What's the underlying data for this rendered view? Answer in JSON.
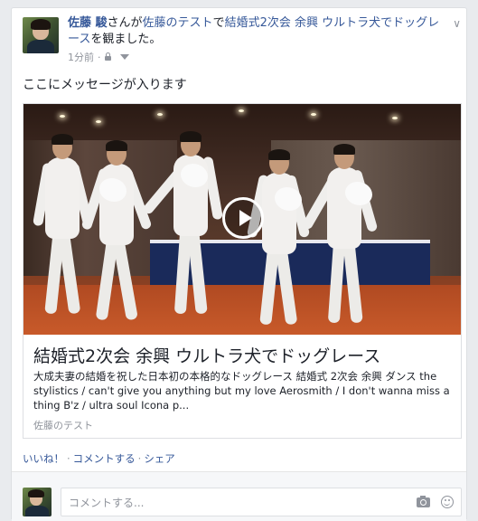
{
  "post": {
    "author": "佐藤 駿",
    "verb_pre": "さんが",
    "page_name": "佐藤のテスト",
    "verb_mid": "で",
    "video_title_link": "結婚式2次会 余興 ウルトラ犬でドッグレース",
    "verb_post": "を観ました。",
    "timestamp": "1分前",
    "timestamp_sep": "·",
    "message": "ここにメッセージが入ります"
  },
  "attachment": {
    "title": "結婚式2次会 余興 ウルトラ犬でドッグレース",
    "description": "大成夫妻の結婚を祝した日本初の本格的なドッグレース 結婚式 2次会 余興 ダンス the stylistics / can't give you anything but my love Aerosmith / I don't wanna miss a thing B'z / ultra soul Icona p...",
    "source": "佐藤のテスト"
  },
  "actions": {
    "like": "いいね！",
    "comment": "コメントする",
    "share": "シェア",
    "sep": "·"
  },
  "comment_box": {
    "placeholder": "コメントする..."
  },
  "icons": [
    "chevron-down-icon",
    "lock-icon",
    "audience-caret-icon",
    "play-icon",
    "camera-icon",
    "emoji-icon"
  ]
}
